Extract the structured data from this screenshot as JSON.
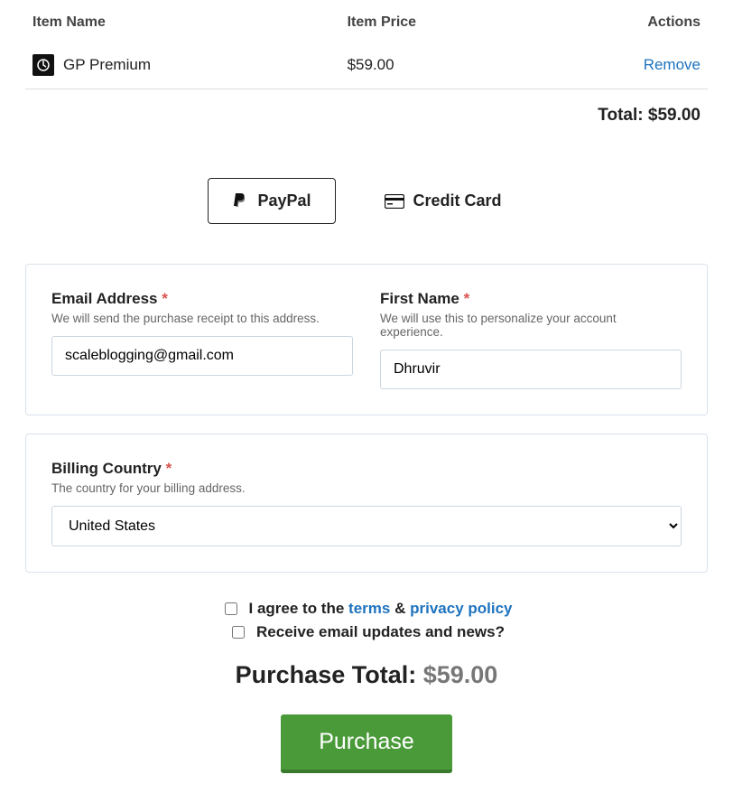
{
  "cart": {
    "headers": {
      "name": "Item Name",
      "price": "Item Price",
      "actions": "Actions"
    },
    "item": {
      "name": "GP Premium",
      "price": "$59.00",
      "remove": "Remove"
    },
    "total_label": "Total:",
    "total_value": "$59.00"
  },
  "payment": {
    "paypal": "PayPal",
    "credit": "Credit Card"
  },
  "fields": {
    "email": {
      "label": "Email Address",
      "help": "We will send the purchase receipt to this address.",
      "value": "scaleblogging@gmail.com"
    },
    "firstname": {
      "label": "First Name",
      "help": "We will use this to personalize your account experience.",
      "value": "Dhruvir"
    },
    "country": {
      "label": "Billing Country",
      "help": "The country for your billing address.",
      "value": "United States"
    }
  },
  "checks": {
    "agree_prefix": "I agree to the",
    "terms": "terms",
    "amp": "&",
    "privacy": "privacy policy",
    "updates": "Receive email updates and news?"
  },
  "summary": {
    "label": "Purchase Total:",
    "value": "$59.00",
    "button": "Purchase"
  }
}
